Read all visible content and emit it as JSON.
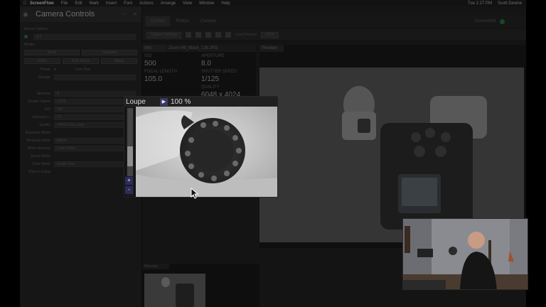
{
  "menubar": {
    "app_name": "ScreenFlow",
    "items": [
      "File",
      "Edit",
      "Mark",
      "Insert",
      "Font",
      "Actions",
      "Arrange",
      "View",
      "Window",
      "Help"
    ],
    "clock": "Tue 1:27 PM",
    "user": "Scott Devine"
  },
  "camera_controls": {
    "title": "Camera Controls",
    "active_camera_label": "Active Camera",
    "camera_model": "Z 6",
    "modes_label": "Modes",
    "seg1": [
      "Shoot",
      "Playback"
    ],
    "seg2": [
      "Video",
      "Auto Focus",
      "Setup"
    ],
    "power_label": "Power",
    "live_view_label": "Live View",
    "storage_label": "Storage",
    "fields": [
      {
        "label": "Aperture",
        "value": "8"
      },
      {
        "label": "Shutter Speed",
        "value": "1/125"
      },
      {
        "label": "ISO",
        "value": "500"
      },
      {
        "label": "Exposure +",
        "value": "0.0"
      },
      {
        "label": "Quality",
        "value": "JPEG Fine Large"
      },
      {
        "label": "Exposure Mode",
        "value": ""
      },
      {
        "label": "Metering Mode",
        "value": "Matrix"
      },
      {
        "label": "White Balance",
        "value": "Color Temp"
      },
      {
        "label": "Focus Mode",
        "value": ""
      },
      {
        "label": "Drive Mode",
        "value": "Single Shot"
      },
      {
        "label": "Mirror Lockup",
        "value": ""
      }
    ]
  },
  "tabs": {
    "items": [
      "Control",
      "Photos",
      "Camera"
    ],
    "status": "Connected"
  },
  "toolbar": {
    "capture_label": "Capture Settings",
    "preview_label": "Card Preview",
    "zoom_value": "100%"
  },
  "info": {
    "tab": "Info",
    "filename": "Zoom H6_Black_136.JPG",
    "iso_label": "ISO",
    "iso_value": "500",
    "aperture_label": "APERTURE",
    "aperture_value": "8.0",
    "focal_label": "FOCAL LENGTH",
    "focal_value": "105.0",
    "shutter_label": "SHUTTER SPEED",
    "shutter_value": "1/125",
    "quality_label": "QUALITY",
    "quality_value": "6048 x 4024"
  },
  "preview": {
    "tab": "Preview"
  },
  "filmstrip": {
    "tab": "Filmstrip"
  },
  "loupe": {
    "title": "Loupe",
    "zoom": "100 %",
    "plus": "+",
    "minus": "-"
  }
}
